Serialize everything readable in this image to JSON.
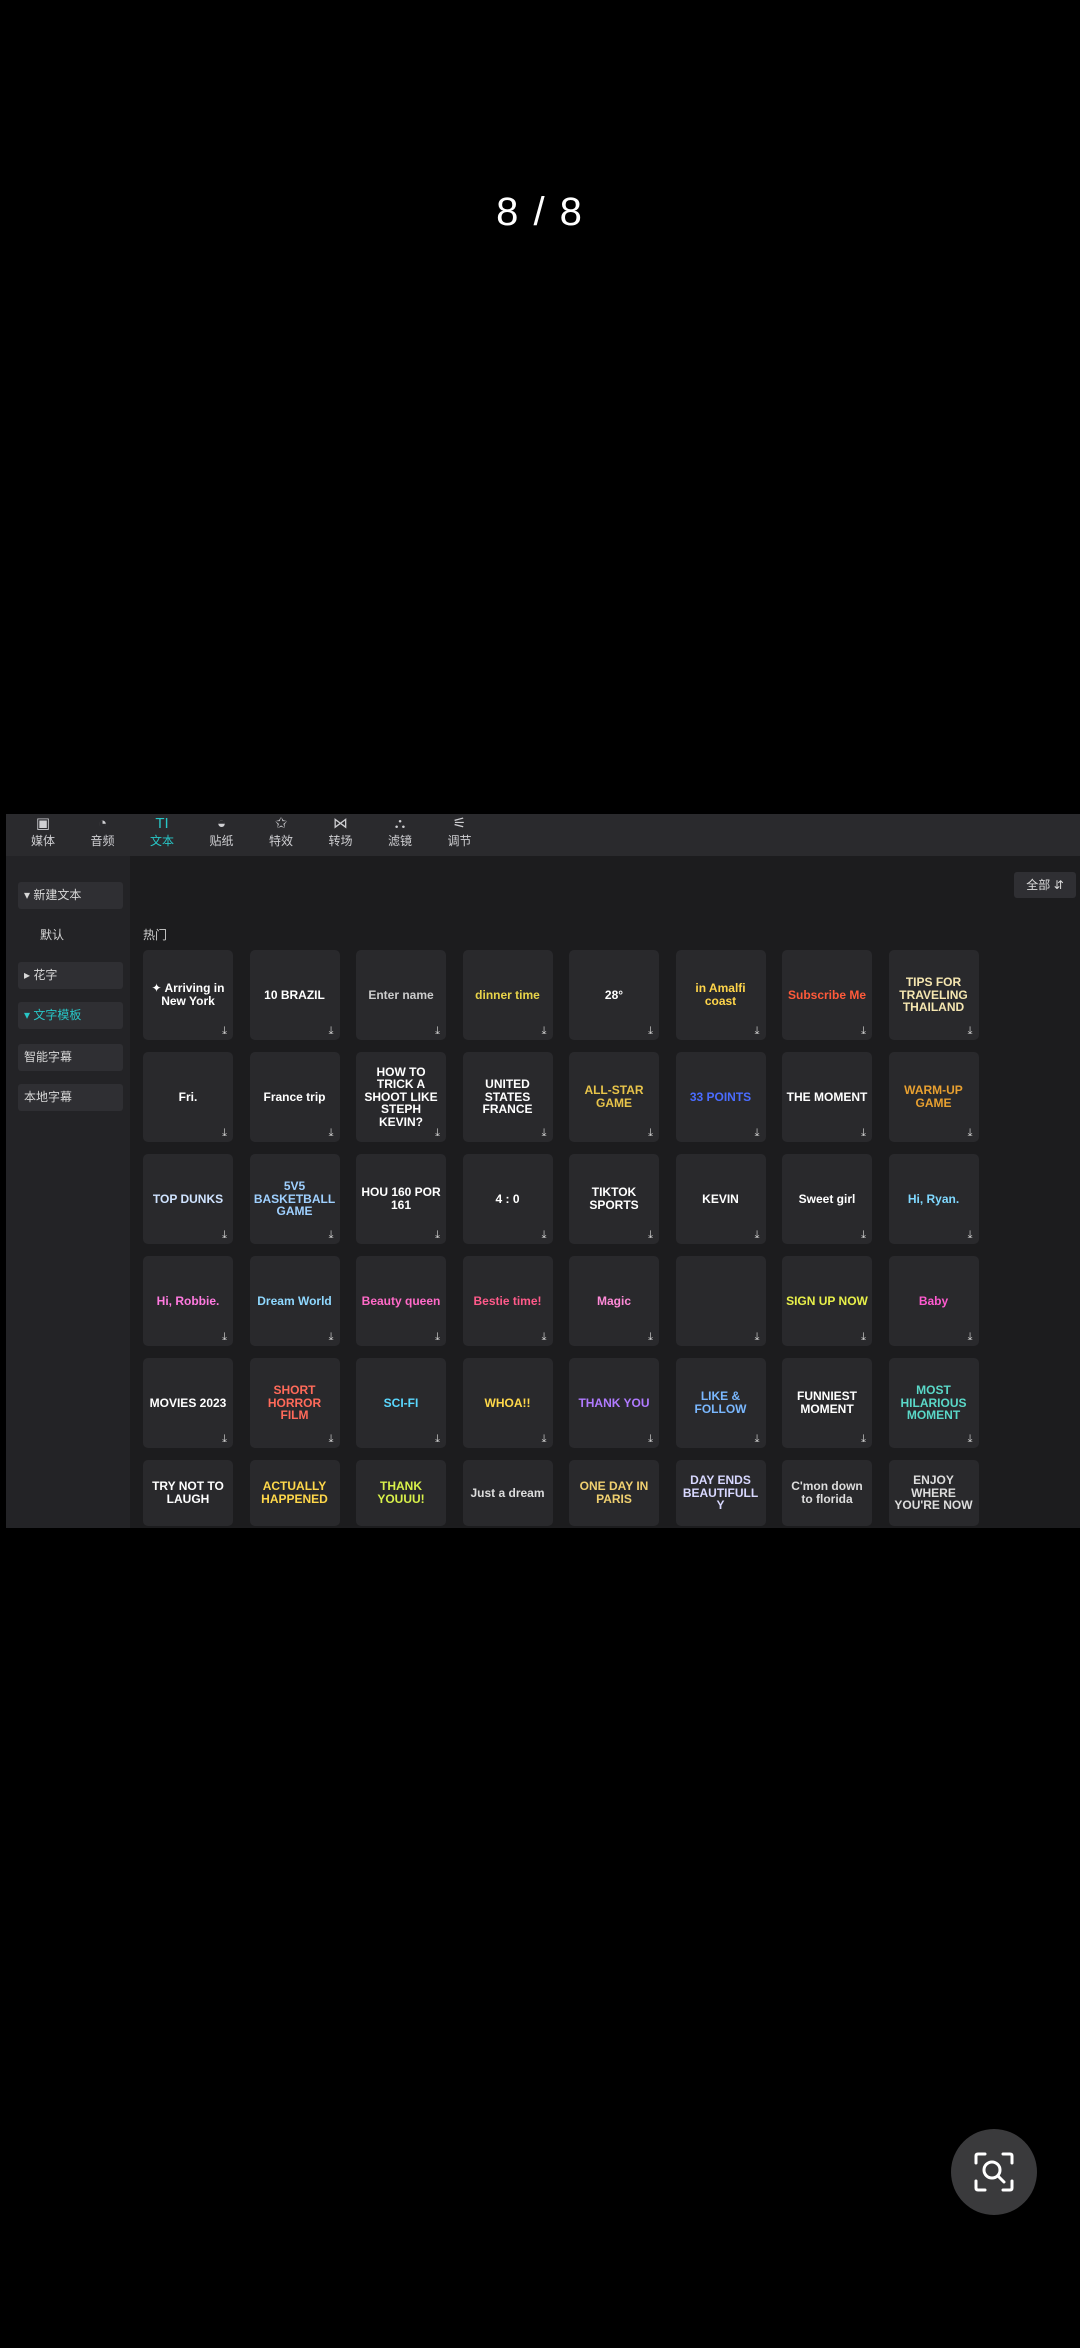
{
  "counter": "8 / 8",
  "toolbar": [
    {
      "icon": "media-icon",
      "glyph": "▣",
      "label": "媒体"
    },
    {
      "icon": "audio-icon",
      "glyph": "◔",
      "label": "音频"
    },
    {
      "icon": "text-icon",
      "glyph": "TI",
      "label": "文本"
    },
    {
      "icon": "sticker-icon",
      "glyph": "◒",
      "label": "贴纸"
    },
    {
      "icon": "effects-icon",
      "glyph": "✩",
      "label": "特效"
    },
    {
      "icon": "transition-icon",
      "glyph": "⋈",
      "label": "转场"
    },
    {
      "icon": "filter-icon",
      "glyph": "⛬",
      "label": "滤镜"
    },
    {
      "icon": "adjust-icon",
      "glyph": "⚟",
      "label": "调节"
    }
  ],
  "sidebar": [
    {
      "label": "▾ 新建文本",
      "style": "box"
    },
    {
      "label": "默认",
      "style": "plain"
    },
    {
      "label": "▸ 花字",
      "style": "box"
    },
    {
      "label": "▾ 文字模板",
      "style": "box sel"
    },
    {
      "label": "智能字幕",
      "style": "box"
    },
    {
      "label": "本地字幕",
      "style": "box"
    }
  ],
  "filter": {
    "label": "全部",
    "icon": "filter-sort-icon"
  },
  "section_title": "热门",
  "templates": [
    [
      {
        "text": "✦ Arriving in New York",
        "color": "#ffffff"
      },
      {
        "text": "10 BRAZIL",
        "color": "#ffffff"
      },
      {
        "text": "Enter name",
        "color": "#cccccc"
      },
      {
        "text": "dinner time",
        "color": "#e8d34a"
      },
      {
        "text": "28°",
        "color": "#ffffff"
      },
      {
        "text": "in Amalfi coast",
        "color": "#ffd54a"
      },
      {
        "text": "Subscribe Me",
        "color": "#ff5a3a"
      },
      {
        "text": "TIPS FOR TRAVELING THAILAND",
        "color": "#f5e6b0"
      }
    ],
    [
      {
        "text": "Fri.",
        "color": "#ffffff"
      },
      {
        "text": "France trip",
        "color": "#ffffff"
      },
      {
        "text": "HOW TO TRICK A SHOOT LIKE STEPH KEVIN?",
        "color": "#ffffff"
      },
      {
        "text": "UNITED STATES FRANCE",
        "color": "#ffffff"
      },
      {
        "text": "ALL-STAR GAME",
        "color": "#e8c44a"
      },
      {
        "text": "33 POINTS",
        "color": "#4a6cff"
      },
      {
        "text": "THE MOMENT",
        "color": "#ffffff"
      },
      {
        "text": "WARM-UP GAME",
        "color": "#e8a030"
      }
    ],
    [
      {
        "text": "TOP DUNKS",
        "color": "#cfe3ff"
      },
      {
        "text": "5V5 BASKETBALL GAME",
        "color": "#9fd0ff"
      },
      {
        "text": "HOU 160 POR 161",
        "color": "#ffffff"
      },
      {
        "text": "4 : 0",
        "color": "#ffffff"
      },
      {
        "text": "TIKTOK SPORTS",
        "color": "#ffffff"
      },
      {
        "text": "KEVIN",
        "color": "#ffffff"
      },
      {
        "text": "Sweet girl",
        "color": "#ffffff"
      },
      {
        "text": "Hi, Ryan.",
        "color": "#7fd8ff"
      }
    ],
    [
      {
        "text": "Hi, Robbie.",
        "color": "#ff7ae0"
      },
      {
        "text": "Dream World",
        "color": "#8fd8ff"
      },
      {
        "text": "Beauty queen",
        "color": "#ff6ac8"
      },
      {
        "text": "Bestie time!",
        "color": "#ff5a8a"
      },
      {
        "text": "Magic",
        "color": "#ff8ad8"
      },
      {
        "text": "",
        "color": "#ffffff"
      },
      {
        "text": "SIGN UP NOW",
        "color": "#e8f04a"
      },
      {
        "text": "Baby",
        "color": "#ff5ad0"
      }
    ],
    [
      {
        "text": "MOVIES 2023",
        "color": "#ffffff"
      },
      {
        "text": "SHORT HORROR FILM",
        "color": "#ff6a5a"
      },
      {
        "text": "SCI-FI",
        "color": "#5ad8ff"
      },
      {
        "text": "WHOA!!",
        "color": "#ffd84a"
      },
      {
        "text": "THANK YOU",
        "color": "#b07aff"
      },
      {
        "text": "LIKE & FOLLOW",
        "color": "#7ab8ff"
      },
      {
        "text": "FUNNIEST MOMENT",
        "color": "#ffffff"
      },
      {
        "text": "MOST HILARIOUS MOMENT",
        "color": "#5ad8c8"
      }
    ],
    [
      {
        "text": "TRY NOT TO LAUGH",
        "color": "#ffffff"
      },
      {
        "text": "ACTUALLY HAPPENED",
        "color": "#ffd84a"
      },
      {
        "text": "THANK YOUUU!",
        "color": "#d8f04a"
      },
      {
        "text": "Just a dream",
        "color": "#dddddd"
      },
      {
        "text": "ONE DAY IN PARIS",
        "color": "#f0d070"
      },
      {
        "text": "DAY ENDS BEAUTIFULLY",
        "color": "#d8d8ff"
      },
      {
        "text": "C'mon down to florida",
        "color": "#dddddd"
      },
      {
        "text": "ENJOY WHERE YOU'RE NOW",
        "color": "#dddddd"
      }
    ]
  ],
  "download_glyph": "⤓",
  "lens_icon": "visual-search-icon"
}
